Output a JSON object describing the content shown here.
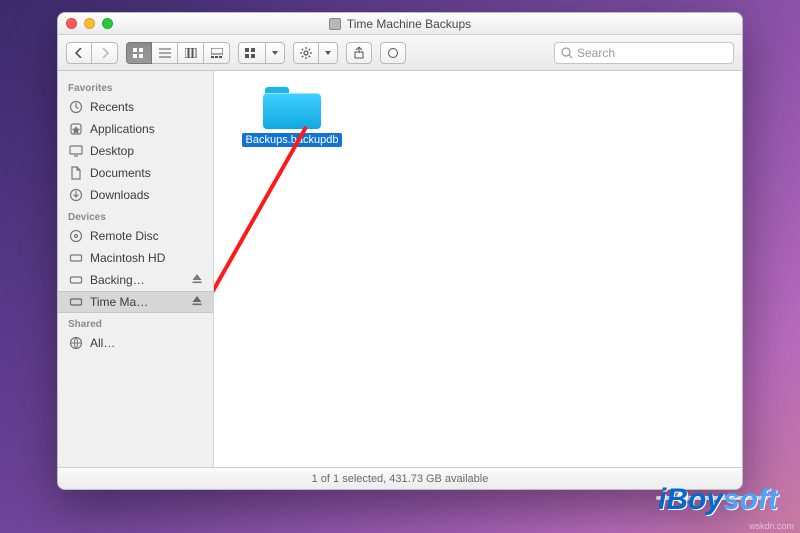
{
  "window": {
    "title": "Time Machine Backups"
  },
  "toolbar": {
    "search_placeholder": "Search"
  },
  "sidebar": {
    "favorites_label": "Favorites",
    "favorites": [
      {
        "label": "Recents",
        "icon": "clock-icon"
      },
      {
        "label": "Applications",
        "icon": "app-icon"
      },
      {
        "label": "Desktop",
        "icon": "desktop-icon"
      },
      {
        "label": "Documents",
        "icon": "doc-icon"
      },
      {
        "label": "Downloads",
        "icon": "download-icon"
      }
    ],
    "devices_label": "Devices",
    "devices": [
      {
        "label": "Remote Disc",
        "icon": "disc-icon",
        "eject": false,
        "selected": false
      },
      {
        "label": "Macintosh HD",
        "icon": "drive-icon",
        "eject": false,
        "selected": false
      },
      {
        "label": "Backing…",
        "icon": "drive-icon",
        "eject": true,
        "selected": false
      },
      {
        "label": "Time Ma…",
        "icon": "drive-icon",
        "eject": true,
        "selected": true
      }
    ],
    "shared_label": "Shared",
    "shared": [
      {
        "label": "All…",
        "icon": "globe-icon"
      }
    ]
  },
  "content": {
    "folder_name": "Backups.backupdb"
  },
  "status": {
    "text": "1 of 1 selected, 431.73 GB available"
  },
  "watermark": {
    "a": "iBoy",
    "b": "soft"
  },
  "source": "wskdn.com"
}
